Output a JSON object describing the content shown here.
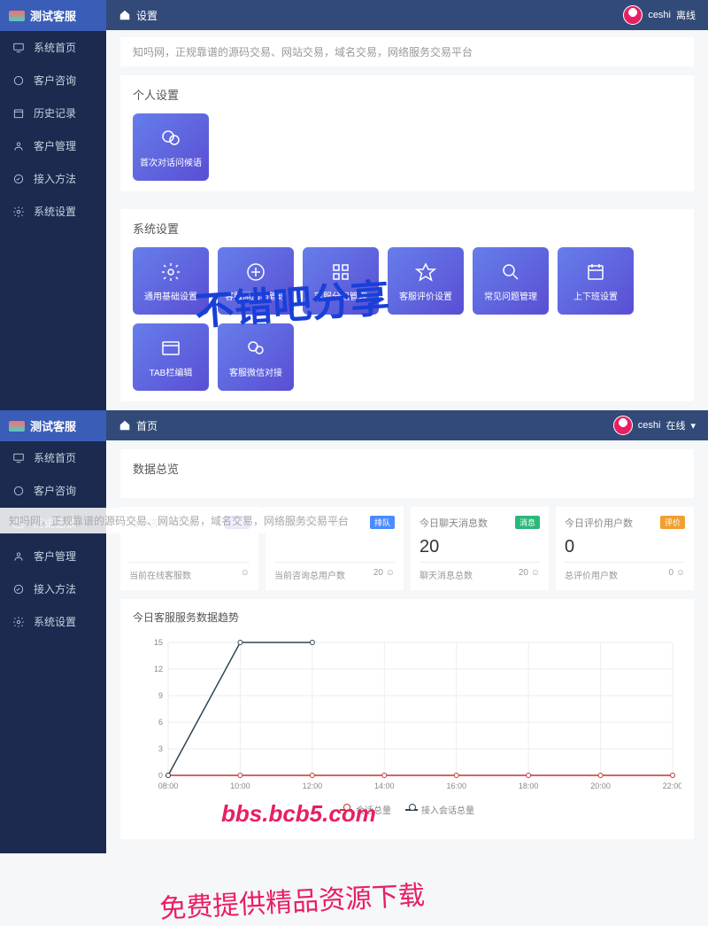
{
  "brand": "测试客服",
  "user": {
    "name": "ceshi",
    "status_top": "离线",
    "status_bottom": "在线"
  },
  "banner_text": "知吗网，正规靠谱的源码交易、网站交易，域名交易，网络服务交易平台",
  "sidebar": {
    "items": [
      {
        "label": "系统首页",
        "icon": "monitor"
      },
      {
        "label": "客户咨询",
        "icon": "circle"
      },
      {
        "label": "历史记录",
        "icon": "calendar"
      },
      {
        "label": "客户管理",
        "icon": "user"
      },
      {
        "label": "接入方法",
        "icon": "plug"
      },
      {
        "label": "系统设置",
        "icon": "gear"
      }
    ]
  },
  "page_top": {
    "breadcrumb": "设置",
    "section_personal": "个人设置",
    "section_system": "系统设置",
    "personal_tiles": [
      {
        "label": "首次对话问候语",
        "icon": "chat"
      }
    ],
    "system_tiles": [
      {
        "label": "通用基础设置",
        "icon": "gear"
      },
      {
        "label": "客服添加与管理",
        "icon": "plus"
      },
      {
        "label": "客服分组管理",
        "icon": "grid"
      },
      {
        "label": "客服评价设置",
        "icon": "star"
      },
      {
        "label": "常见问题管理",
        "icon": "search"
      },
      {
        "label": "上下班设置",
        "icon": "schedule"
      },
      {
        "label": "TAB栏编辑",
        "icon": "window"
      },
      {
        "label": "客服微信对接",
        "icon": "wechat"
      }
    ]
  },
  "page_bottom": {
    "breadcrumb": "首页",
    "overview_title": "数据总览",
    "stats": [
      {
        "label": "当前咨询用户数",
        "badge": "咨询",
        "badge_cls": "b-purple",
        "value": "",
        "sub_label": "当前在线客服数",
        "sub_value": ""
      },
      {
        "label": "当前排队用户数",
        "badge": "排队",
        "badge_cls": "b-blue",
        "value": "",
        "sub_label": "当前咨询总用户数",
        "sub_value": "20"
      },
      {
        "label": "今日聊天消息数",
        "badge": "消息",
        "badge_cls": "b-green",
        "value": "20",
        "sub_label": "聊天消息总数",
        "sub_value": "20"
      },
      {
        "label": "今日评价用户数",
        "badge": "评价",
        "badge_cls": "b-orange",
        "value": "0",
        "sub_label": "总评价用户数",
        "sub_value": "0"
      }
    ],
    "chart_title": "今日客服服务数据趋势"
  },
  "watermarks": {
    "title": "不错吧分享",
    "url": "bbs.bcb5.com",
    "sub": "免费提供精品资源下载"
  },
  "chart_data": {
    "type": "line",
    "x": [
      "08:00",
      "10:00",
      "12:00",
      "14:00",
      "16:00",
      "18:00",
      "20:00",
      "22:00"
    ],
    "ylim": [
      0,
      15
    ],
    "yticks": [
      0,
      3,
      6,
      9,
      12,
      15
    ],
    "series": [
      {
        "name": "会话总量",
        "color": "#c23531",
        "values": [
          0,
          0,
          0,
          0,
          0,
          0,
          0,
          0
        ]
      },
      {
        "name": "接入会话总量",
        "color": "#2f4554",
        "values": [
          0,
          15,
          15,
          null,
          null,
          null,
          null,
          null
        ]
      }
    ],
    "legend": [
      "会话总量",
      "接入会话总量"
    ]
  }
}
